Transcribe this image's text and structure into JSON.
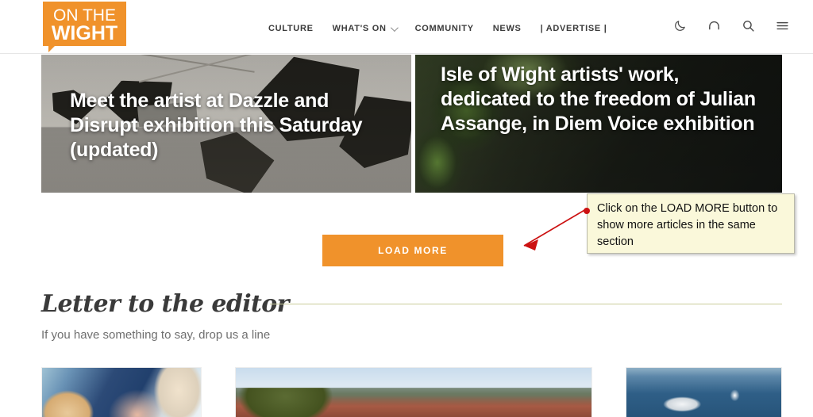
{
  "site": {
    "logo_line1": "ON THE",
    "logo_line2": "WIGHT",
    "brand_color": "#f0922b"
  },
  "header": {
    "nav": [
      {
        "label": "CULTURE",
        "has_caret": false
      },
      {
        "label": "WHAT'S ON",
        "has_caret": true
      },
      {
        "label": "COMMUNITY",
        "has_caret": false
      },
      {
        "label": "NEWS",
        "has_caret": false
      },
      {
        "label": "| ADVERTISE |",
        "has_caret": false
      }
    ],
    "icons": [
      {
        "name": "dark-mode-moon-icon"
      },
      {
        "name": "audio-headphones-icon"
      },
      {
        "name": "search-icon"
      },
      {
        "name": "hamburger-menu-icon"
      }
    ]
  },
  "hero": {
    "cards": [
      {
        "title": "Meet the artist at Dazzle and Disrupt exhibition this Saturday (updated)"
      },
      {
        "title": "Isle of Wight artists' work, dedicated to the freedom of Julian Assange, in Diem Voice exhibition"
      }
    ]
  },
  "load_more": {
    "label": "LOAD MORE",
    "color": "#f0922b"
  },
  "annotation": {
    "text": "Click on the LOAD MORE button to show more articles in the same section",
    "background": "#faf8da",
    "arrow_color": "#cc1111"
  },
  "letter_section": {
    "title": "Letter to the editor",
    "subtitle": "If you have something to say, drop us a line",
    "rule_color": "#c9cc9a"
  },
  "cards": [
    {
      "image": "children-playing-photo"
    },
    {
      "image": "town-rooftops-photo"
    },
    {
      "image": "ship-at-sea-photo"
    }
  ]
}
